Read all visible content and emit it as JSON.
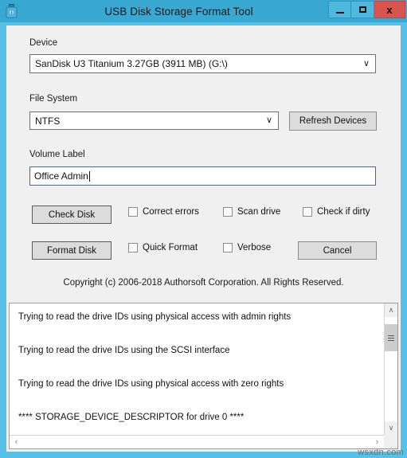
{
  "window": {
    "title": "USB Disk Storage Format Tool",
    "icon": "usb-drive-icon",
    "accent_color": "#39a9d4",
    "border_color": "#57c1e8",
    "close_color": "#d9534f",
    "client_bg": "#f0f0f0"
  },
  "caption": {
    "minimize": "–",
    "maximize": "□",
    "close": "x"
  },
  "device": {
    "label": "Device",
    "value": "SanDisk U3 Titanium 3.27GB (3911 MB)  (G:\\)",
    "chevron": "∨"
  },
  "file_system": {
    "label": "File System",
    "value": "NTFS",
    "chevron": "∨"
  },
  "refresh_button": {
    "label": "Refresh Devices"
  },
  "volume_label": {
    "label": "Volume Label",
    "value": "Office Admin"
  },
  "check_row": {
    "button": "Check Disk",
    "options": [
      {
        "label": "Correct errors",
        "checked": false
      },
      {
        "label": "Scan drive",
        "checked": false
      },
      {
        "label": "Check if dirty",
        "checked": false
      }
    ]
  },
  "format_row": {
    "button": "Format Disk",
    "options": [
      {
        "label": "Quick Format",
        "checked": false
      },
      {
        "label": "Verbose",
        "checked": false
      }
    ],
    "cancel_button": "Cancel"
  },
  "copyright": "Copyright (c) 2006-2018 Authorsoft Corporation. All Rights Reserved.",
  "log": {
    "lines": [
      "Trying to read the drive IDs using physical access with admin rights",
      "Trying to read the drive IDs using the SCSI interface",
      "Trying to read the drive IDs using physical access with zero rights",
      "**** STORAGE_DEVICE_DESCRIPTOR for drive 0 ****"
    ],
    "scroll_up": "∧",
    "scroll_down": "∨",
    "scroll_left": "‹",
    "scroll_right": "›"
  },
  "watermark": "wsxdn.com"
}
